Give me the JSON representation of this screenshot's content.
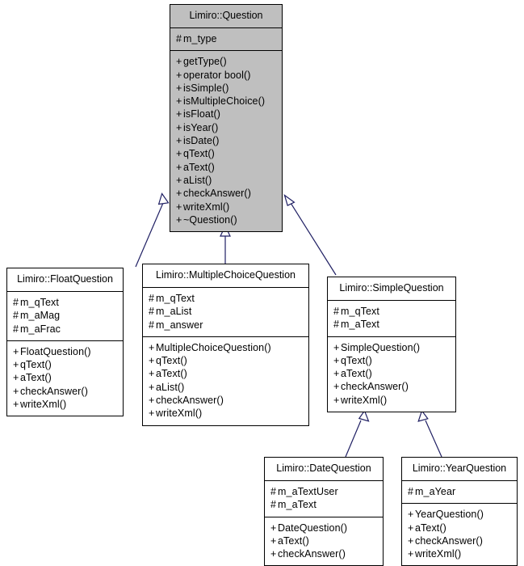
{
  "diagram": {
    "type": "uml-class-inheritance",
    "title": "Limiro::Question inheritance diagram",
    "background_color": "#ffffff",
    "line_color": "#1f1f63",
    "border_color": "#000000",
    "root_fill_color": "#bfbfbf",
    "node_fill_color": "#ffffff",
    "text_color": "#000000"
  },
  "classes": [
    {
      "id": "question",
      "name": "Limiro::Question",
      "highlighted": true,
      "attributes": [
        {
          "visibility": "#",
          "label": "m_type"
        }
      ],
      "operations": [
        {
          "visibility": "+",
          "label": "getType()"
        },
        {
          "visibility": "+",
          "label": "operator bool()"
        },
        {
          "visibility": "+",
          "label": "isSimple()"
        },
        {
          "visibility": "+",
          "label": "isMultipleChoice()"
        },
        {
          "visibility": "+",
          "label": "isFloat()"
        },
        {
          "visibility": "+",
          "label": "isYear()"
        },
        {
          "visibility": "+",
          "label": "isDate()"
        },
        {
          "visibility": "+",
          "label": "qText()"
        },
        {
          "visibility": "+",
          "label": "aText()"
        },
        {
          "visibility": "+",
          "label": "aList()"
        },
        {
          "visibility": "+",
          "label": "checkAnswer()"
        },
        {
          "visibility": "+",
          "label": "writeXml()"
        },
        {
          "visibility": "+",
          "label": "~Question()"
        }
      ]
    },
    {
      "id": "floatquestion",
      "name": "Limiro::FloatQuestion",
      "highlighted": false,
      "attributes": [
        {
          "visibility": "#",
          "label": "m_qText"
        },
        {
          "visibility": "#",
          "label": "m_aMag"
        },
        {
          "visibility": "#",
          "label": "m_aFrac"
        }
      ],
      "operations": [
        {
          "visibility": "+",
          "label": "FloatQuestion()"
        },
        {
          "visibility": "+",
          "label": "qText()"
        },
        {
          "visibility": "+",
          "label": "aText()"
        },
        {
          "visibility": "+",
          "label": "checkAnswer()"
        },
        {
          "visibility": "+",
          "label": "writeXml()"
        }
      ]
    },
    {
      "id": "multiplechoicequestion",
      "name": "Limiro::MultipleChoiceQuestion",
      "highlighted": false,
      "attributes": [
        {
          "visibility": "#",
          "label": "m_qText"
        },
        {
          "visibility": "#",
          "label": "m_aList"
        },
        {
          "visibility": "#",
          "label": "m_answer"
        }
      ],
      "operations": [
        {
          "visibility": "+",
          "label": "MultipleChoiceQuestion()"
        },
        {
          "visibility": "+",
          "label": "qText()"
        },
        {
          "visibility": "+",
          "label": "aText()"
        },
        {
          "visibility": "+",
          "label": "aList()"
        },
        {
          "visibility": "+",
          "label": "checkAnswer()"
        },
        {
          "visibility": "+",
          "label": "writeXml()"
        }
      ]
    },
    {
      "id": "simplequestion",
      "name": "Limiro::SimpleQuestion",
      "highlighted": false,
      "attributes": [
        {
          "visibility": "#",
          "label": "m_qText"
        },
        {
          "visibility": "#",
          "label": "m_aText"
        }
      ],
      "operations": [
        {
          "visibility": "+",
          "label": "SimpleQuestion()"
        },
        {
          "visibility": "+",
          "label": "qText()"
        },
        {
          "visibility": "+",
          "label": "aText()"
        },
        {
          "visibility": "+",
          "label": "checkAnswer()"
        },
        {
          "visibility": "+",
          "label": "writeXml()"
        }
      ]
    },
    {
      "id": "datequestion",
      "name": "Limiro::DateQuestion",
      "highlighted": false,
      "attributes": [
        {
          "visibility": "#",
          "label": "m_aTextUser"
        },
        {
          "visibility": "#",
          "label": "m_aText"
        }
      ],
      "operations": [
        {
          "visibility": "+",
          "label": "DateQuestion()"
        },
        {
          "visibility": "+",
          "label": "aText()"
        },
        {
          "visibility": "+",
          "label": "checkAnswer()"
        }
      ]
    },
    {
      "id": "yearquestion",
      "name": "Limiro::YearQuestion",
      "highlighted": false,
      "attributes": [
        {
          "visibility": "#",
          "label": "m_aYear"
        }
      ],
      "operations": [
        {
          "visibility": "+",
          "label": "YearQuestion()"
        },
        {
          "visibility": "+",
          "label": "aText()"
        },
        {
          "visibility": "+",
          "label": "checkAnswer()"
        },
        {
          "visibility": "+",
          "label": "writeXml()"
        }
      ]
    }
  ],
  "inheritance_edges": [
    {
      "from": "floatquestion",
      "to": "question"
    },
    {
      "from": "multiplechoicequestion",
      "to": "question"
    },
    {
      "from": "simplequestion",
      "to": "question"
    },
    {
      "from": "datequestion",
      "to": "simplequestion"
    },
    {
      "from": "yearquestion",
      "to": "simplequestion"
    }
  ]
}
